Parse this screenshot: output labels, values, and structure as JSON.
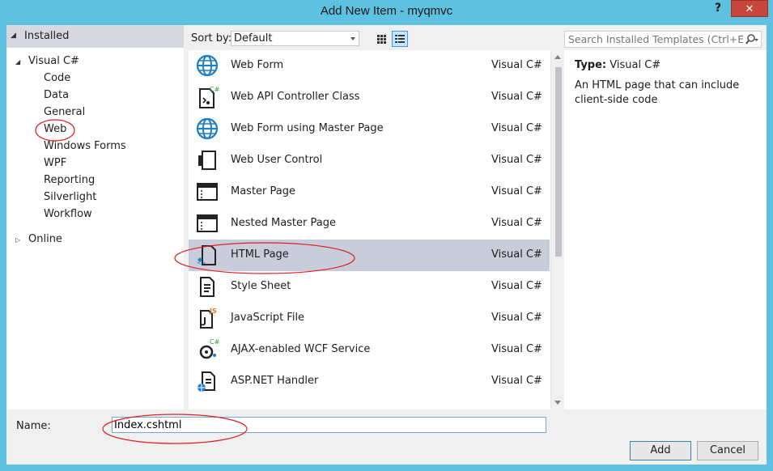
{
  "window": {
    "title": "Add New Item - myqmvc",
    "help_label": "?",
    "close_label": "✕"
  },
  "left_panel": {
    "installed_label": "Installed",
    "tree": [
      {
        "label": "Visual C#",
        "level": 0,
        "expanded": true
      },
      {
        "label": "Code",
        "level": 1
      },
      {
        "label": "Data",
        "level": 1
      },
      {
        "label": "General",
        "level": 1
      },
      {
        "label": "Web",
        "level": 1,
        "selected": true
      },
      {
        "label": "Windows Forms",
        "level": 1
      },
      {
        "label": "WPF",
        "level": 1
      },
      {
        "label": "Reporting",
        "level": 1
      },
      {
        "label": "Silverlight",
        "level": 1
      },
      {
        "label": "Workflow",
        "level": 1
      },
      {
        "label": "Online",
        "level": 0,
        "expanded": false
      }
    ]
  },
  "toolbar": {
    "sort_label": "Sort by:",
    "sort_value": "Default"
  },
  "search": {
    "placeholder": "Search Installed Templates (Ctrl+E)"
  },
  "templates": [
    {
      "name": "Web Form",
      "lang": "Visual C#",
      "icon": "globe-icon"
    },
    {
      "name": "Web API Controller Class",
      "lang": "Visual C#",
      "icon": "controller-class-icon"
    },
    {
      "name": "Web Form using Master Page",
      "lang": "Visual C#",
      "icon": "globe-icon"
    },
    {
      "name": "Web User Control",
      "lang": "Visual C#",
      "icon": "user-control-icon"
    },
    {
      "name": "Master Page",
      "lang": "Visual C#",
      "icon": "master-page-icon"
    },
    {
      "name": "Nested Master Page",
      "lang": "Visual C#",
      "icon": "master-page-icon"
    },
    {
      "name": "HTML Page",
      "lang": "Visual C#",
      "icon": "html-page-icon",
      "selected": true
    },
    {
      "name": "Style Sheet",
      "lang": "Visual C#",
      "icon": "style-sheet-icon"
    },
    {
      "name": "JavaScript File",
      "lang": "Visual C#",
      "icon": "javascript-file-icon"
    },
    {
      "name": "AJAX-enabled WCF Service",
      "lang": "Visual C#",
      "icon": "wcf-service-icon"
    },
    {
      "name": "ASP.NET Handler",
      "lang": "Visual C#",
      "icon": "handler-icon"
    }
  ],
  "details": {
    "type_label": "Type:",
    "type_value": "Visual C#",
    "description": "An HTML page that can include client-side code"
  },
  "bottom": {
    "name_label": "Name:",
    "name_value": "Index.cshtml",
    "add_label": "Add",
    "cancel_label": "Cancel"
  },
  "colors": {
    "title_bar": "#5ec1e0",
    "selected_row": "#c9cddb",
    "annotation": "#e02020",
    "close_button": "#c7463e"
  }
}
